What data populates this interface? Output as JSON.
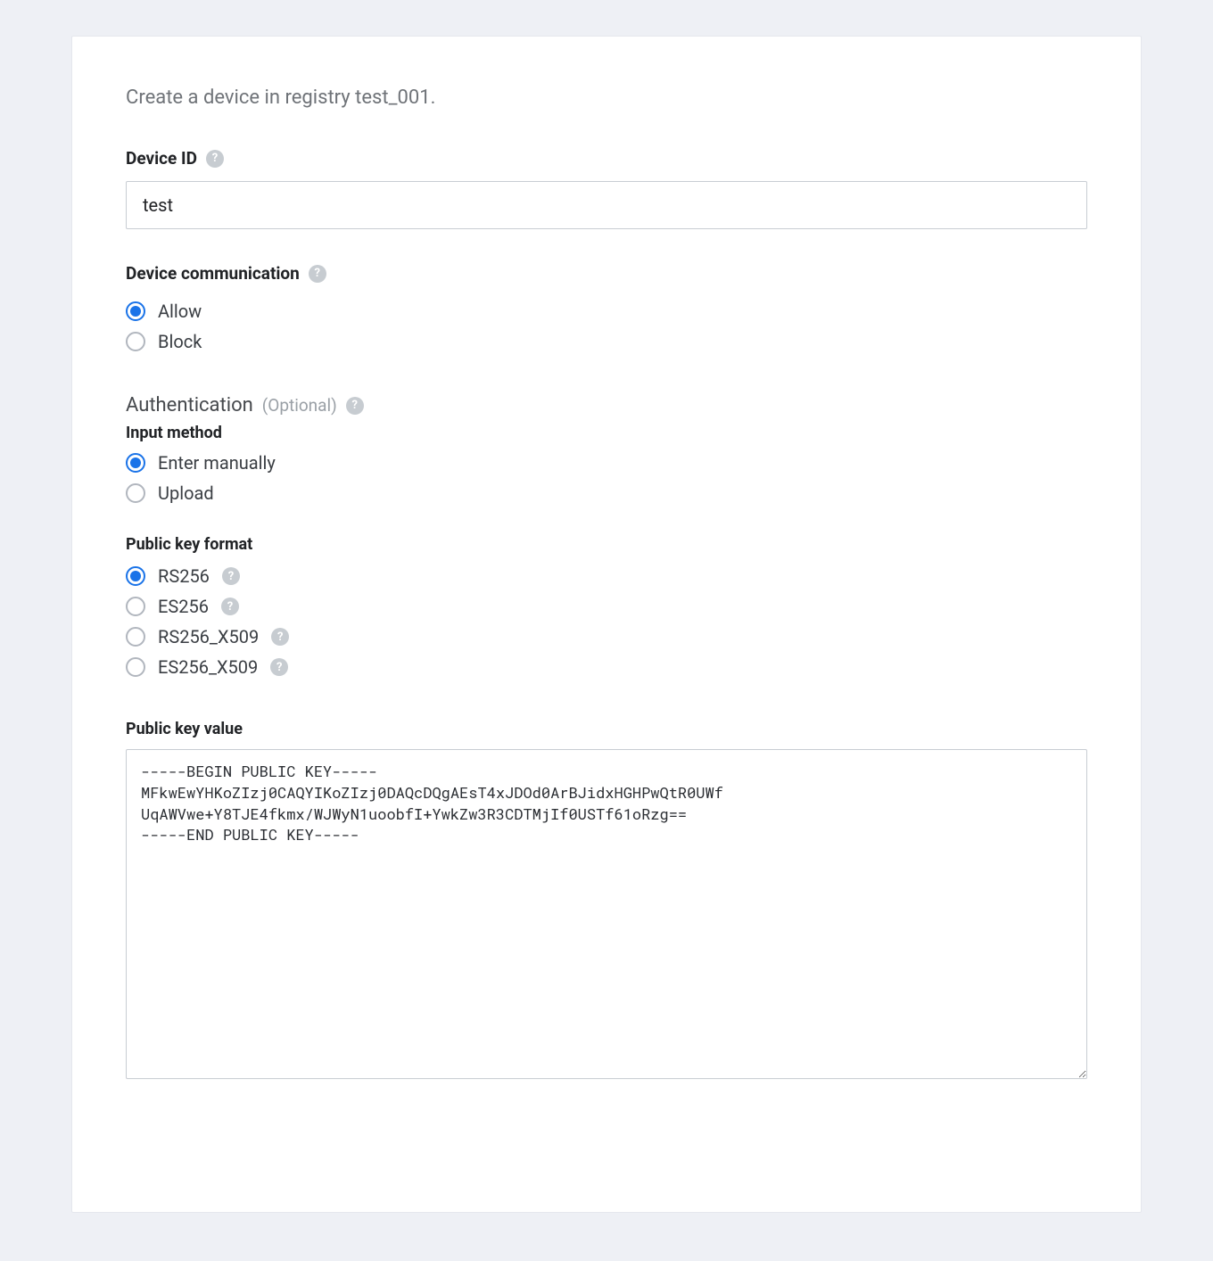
{
  "intro": "Create a device in registry test_001.",
  "help_glyph": "?",
  "device_id": {
    "label": "Device ID",
    "value": "test"
  },
  "device_comm": {
    "label": "Device communication",
    "options": [
      {
        "label": "Allow",
        "selected": true
      },
      {
        "label": "Block",
        "selected": false
      }
    ]
  },
  "auth": {
    "label": "Authentication",
    "optional": "(Optional)"
  },
  "input_method": {
    "label": "Input method",
    "options": [
      {
        "label": "Enter manually",
        "selected": true
      },
      {
        "label": "Upload",
        "selected": false
      }
    ]
  },
  "key_format": {
    "label": "Public key format",
    "options": [
      {
        "label": "RS256",
        "selected": true
      },
      {
        "label": "ES256",
        "selected": false
      },
      {
        "label": "RS256_X509",
        "selected": false
      },
      {
        "label": "ES256_X509",
        "selected": false
      }
    ]
  },
  "key_value": {
    "label": "Public key value",
    "value": "-----BEGIN PUBLIC KEY-----\nMFkwEwYHKoZIzj0CAQYIKoZIzj0DAQcDQgAEsT4xJDOd0ArBJidxHGHPwQtR0UWf\nUqAWVwe+Y8TJE4fkmx/WJWyN1uoobfI+YwkZw3R3CDTMjIf0USTf61oRzg==\n-----END PUBLIC KEY-----"
  }
}
